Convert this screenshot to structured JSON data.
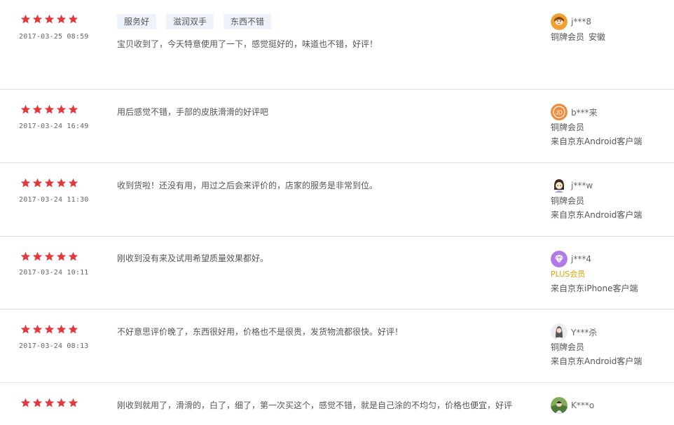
{
  "colors": {
    "star": "#e4393c",
    "plus": "#e4a300",
    "tag_bg": "#eef2fb",
    "divider": "#dedede"
  },
  "reviews": [
    {
      "rating": 5,
      "date": "2017-03-25 08:59",
      "tags": [
        "服务好",
        "滋润双手",
        "东西不错"
      ],
      "content": "宝贝收到了，今天特意使用了一下，感觉挺好的，味道也不错，好评！",
      "user": {
        "name": "j***8",
        "level": "铜牌会员",
        "location": "安徽",
        "client": "",
        "avatar_icon": "avatar-girl-orange-icon"
      }
    },
    {
      "rating": 5,
      "date": "2017-03-24 16:49",
      "tags": [],
      "content": "用后感觉不错，手部的皮肤滑滑的好评吧",
      "user": {
        "name": "b***来",
        "level": "铜牌会员",
        "location": "",
        "client": "来自京东Android客户端",
        "avatar_icon": "avatar-jd-icon"
      }
    },
    {
      "rating": 5,
      "date": "2017-03-24 11:30",
      "tags": [],
      "content": "收到货啦！还没有用，用过之后会来评价的，店家的服务是非常到位。",
      "user": {
        "name": "j***w",
        "level": "铜牌会员",
        "location": "",
        "client": "来自京东Android客户端",
        "avatar_icon": "avatar-cartoon-girl-icon"
      }
    },
    {
      "rating": 5,
      "date": "2017-03-24 10:11",
      "tags": [],
      "content": "刚收到没有来及试用希望质量效果都好。",
      "user": {
        "name": "j***4",
        "level": "PLUS会员",
        "location": "",
        "client": "来自京东iPhone客户端",
        "avatar_icon": "avatar-plus-diamond-icon"
      }
    },
    {
      "rating": 5,
      "date": "2017-03-24 08:13",
      "tags": [],
      "content": "不好意思评价晚了，东西很好用，价格也不是很贵，发货物流都很快。好评！",
      "user": {
        "name": "Y***杀",
        "level": "铜牌会员",
        "location": "",
        "client": "来自京东Android客户端",
        "avatar_icon": "avatar-photo-girl-icon"
      }
    },
    {
      "rating": 5,
      "date": "",
      "tags": [],
      "content": "刚收到就用了，滑滑的，白了，细了，第一次买这个，感觉不错，就是自己涂的不均匀，价格也便宜，好评",
      "user": {
        "name": "K***o",
        "level": "",
        "location": "",
        "client": "",
        "avatar_icon": "avatar-photo-outdoor-icon"
      }
    }
  ]
}
